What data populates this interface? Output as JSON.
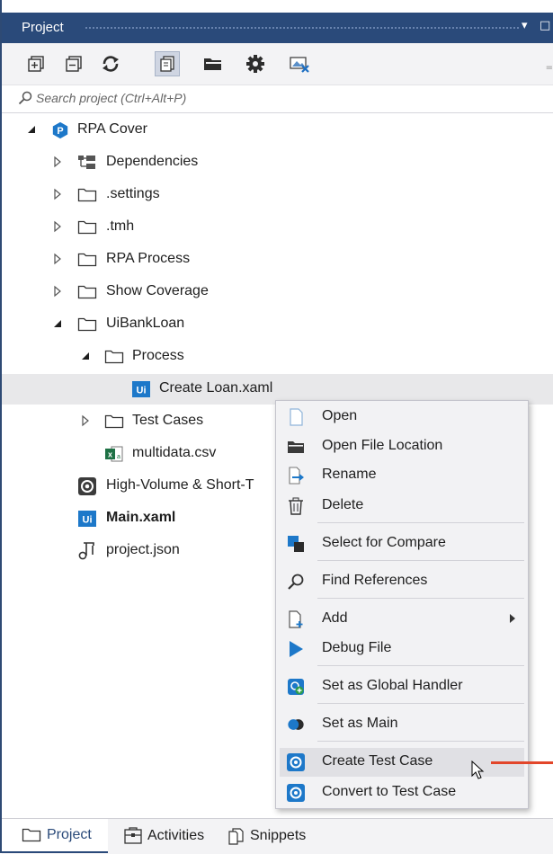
{
  "panel": {
    "title": "Project",
    "pin_glyph": "▾",
    "dock_glyph": "□"
  },
  "toolbar": {
    "buttons": [
      {
        "icon": "expand-all-icon"
      },
      {
        "icon": "collapse-all-icon"
      },
      {
        "icon": "refresh-icon"
      },
      {
        "icon": "show-all-files-icon",
        "active": true
      },
      {
        "icon": "open-folder-icon"
      },
      {
        "icon": "settings-icon"
      },
      {
        "icon": "remove-unused-icon"
      }
    ]
  },
  "search": {
    "placeholder": "Search project (Ctrl+Alt+P)"
  },
  "tree": {
    "root": "RPA Cover",
    "dependencies": "Dependencies",
    "settings": ".settings",
    "tmh": ".tmh",
    "rpa_process": "RPA Process",
    "show_coverage": "Show Coverage",
    "uibankloan": "UiBankLoan",
    "process": "Process",
    "create_loan": "Create Loan.xaml",
    "test_cases": "Test Cases",
    "multidata": "multidata.csv",
    "high_volume": "High-Volume & Short-T",
    "main": "Main.xaml",
    "project_json": "project.json"
  },
  "context_menu": {
    "open": "Open",
    "open_location": "Open File Location",
    "rename": "Rename",
    "delete": "Delete",
    "compare": "Select for Compare",
    "find_refs": "Find References",
    "add": "Add",
    "debug": "Debug File",
    "global_handler": "Set as Global Handler",
    "set_main": "Set as Main",
    "create_test": "Create Test Case",
    "convert_test": "Convert to Test Case"
  },
  "bottom_tabs": {
    "project": "Project",
    "activities": "Activities",
    "snippets": "Snippets"
  },
  "colors": {
    "title_bar": "#2a4a7a",
    "accent_blue": "#1d78c9",
    "arrow_red": "#e2462a"
  }
}
